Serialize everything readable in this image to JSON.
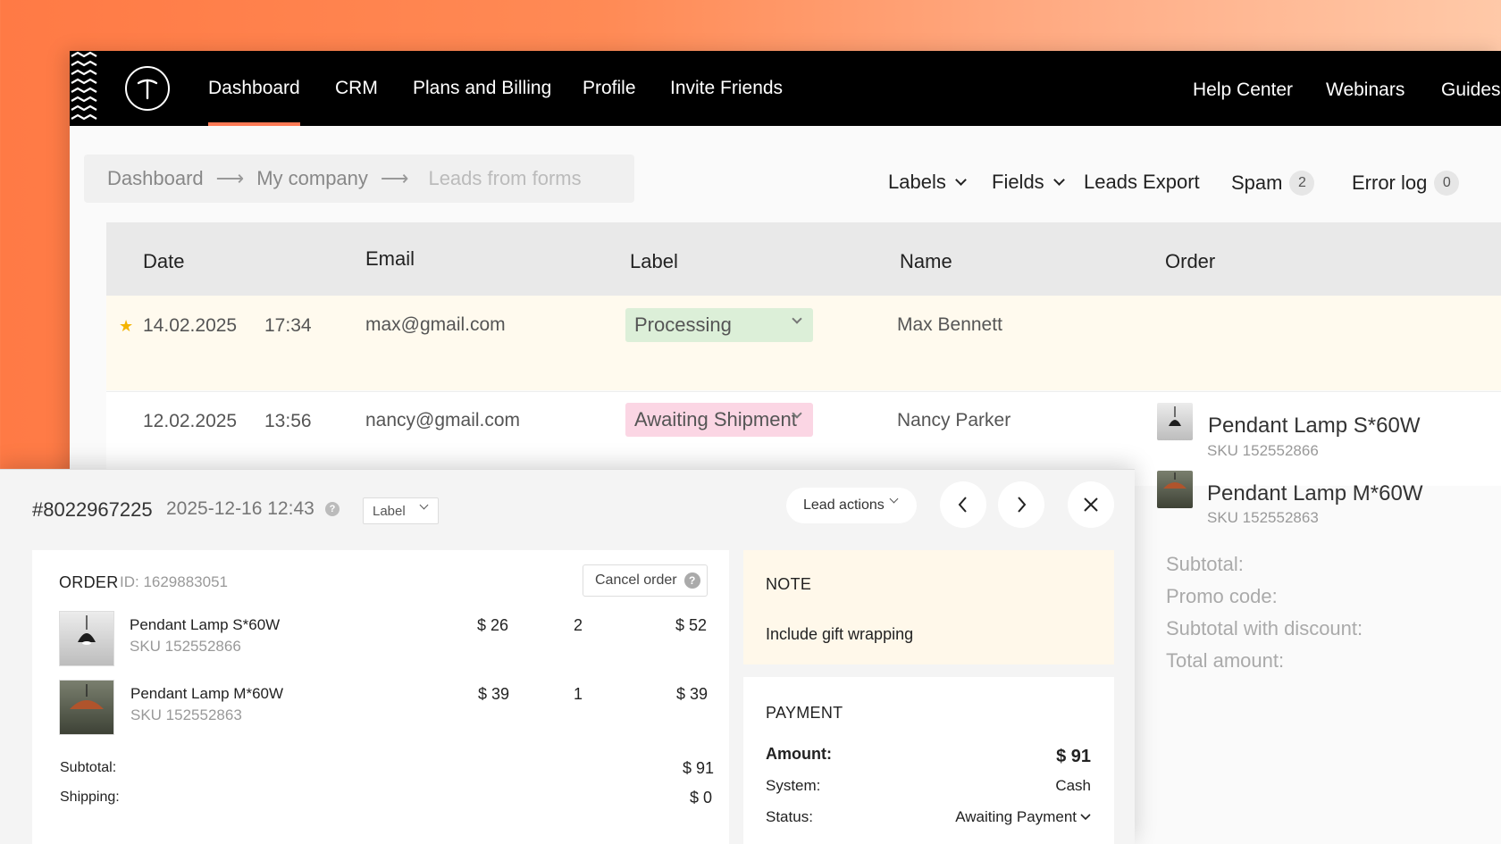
{
  "nav": {
    "items": [
      "Dashboard",
      "CRM",
      "Plans and Billing",
      "Profile",
      "Invite Friends"
    ],
    "right": [
      "Help Center",
      "Webinars",
      "Guides"
    ],
    "logo": "logo-t-icon"
  },
  "breadcrumb": [
    "Dashboard",
    "My company",
    "Leads from forms"
  ],
  "toolbar": {
    "labels": "Labels",
    "fields": "Fields",
    "export": "Leads Export",
    "spam": "Spam",
    "spam_count": "2",
    "errorlog": "Error log",
    "errorlog_count": "0"
  },
  "table": {
    "headers": [
      "Date",
      "Email",
      "Label",
      "Name",
      "Order"
    ],
    "rows": [
      {
        "date": "14.02.2025",
        "time": "17:34",
        "email": "max@gmail.com",
        "label": "Processing",
        "name": "Max Bennett",
        "starred": true
      },
      {
        "date": "12.02.2025",
        "time": "13:56",
        "email": "nancy@gmail.com",
        "label": "Awaiting Shipment",
        "name": "Nancy Parker",
        "starred": false
      }
    ],
    "order_items": [
      {
        "name": "Pendant Lamp S*60W",
        "sku": "SKU 152552866"
      },
      {
        "name": "Pendant Lamp M*60W",
        "sku": "SKU 152552863"
      }
    ],
    "summary": [
      "Subtotal:",
      "Promo code:",
      "Subtotal with discount:",
      "Total amount:"
    ]
  },
  "panel": {
    "order_number": "#8022967225",
    "datetime": "2025-12-16 12:43",
    "label_select": "Label",
    "lead_actions": "Lead actions",
    "order": {
      "title": "ORDER",
      "id": "ID: 1629883051",
      "cancel": "Cancel order",
      "items": [
        {
          "name": "Pendant Lamp S*60W",
          "sku": "SKU 152552866",
          "price": "$ 26",
          "qty": "2",
          "total": "$ 52"
        },
        {
          "name": "Pendant Lamp M*60W",
          "sku": "SKU 152552863",
          "price": "$ 39",
          "qty": "1",
          "total": "$ 39"
        }
      ],
      "subtotal_label": "Subtotal:",
      "subtotal": "$ 91",
      "shipping_label": "Shipping:",
      "shipping": "$ 0"
    },
    "note": {
      "title": "NOTE",
      "text": "Include gift wrapping"
    },
    "payment": {
      "title": "PAYMENT",
      "amount_label": "Amount:",
      "amount": "$ 91",
      "system_label": "System:",
      "system": "Cash",
      "status_label": "Status:",
      "status": "Awaiting Payment"
    }
  },
  "colors": {
    "accent": "#ff7a55",
    "processing_bg": "#dcefd8",
    "awaiting_bg": "#fbd6e4",
    "note_bg": "#fff8ea",
    "highlight_row": "#fffaee"
  }
}
